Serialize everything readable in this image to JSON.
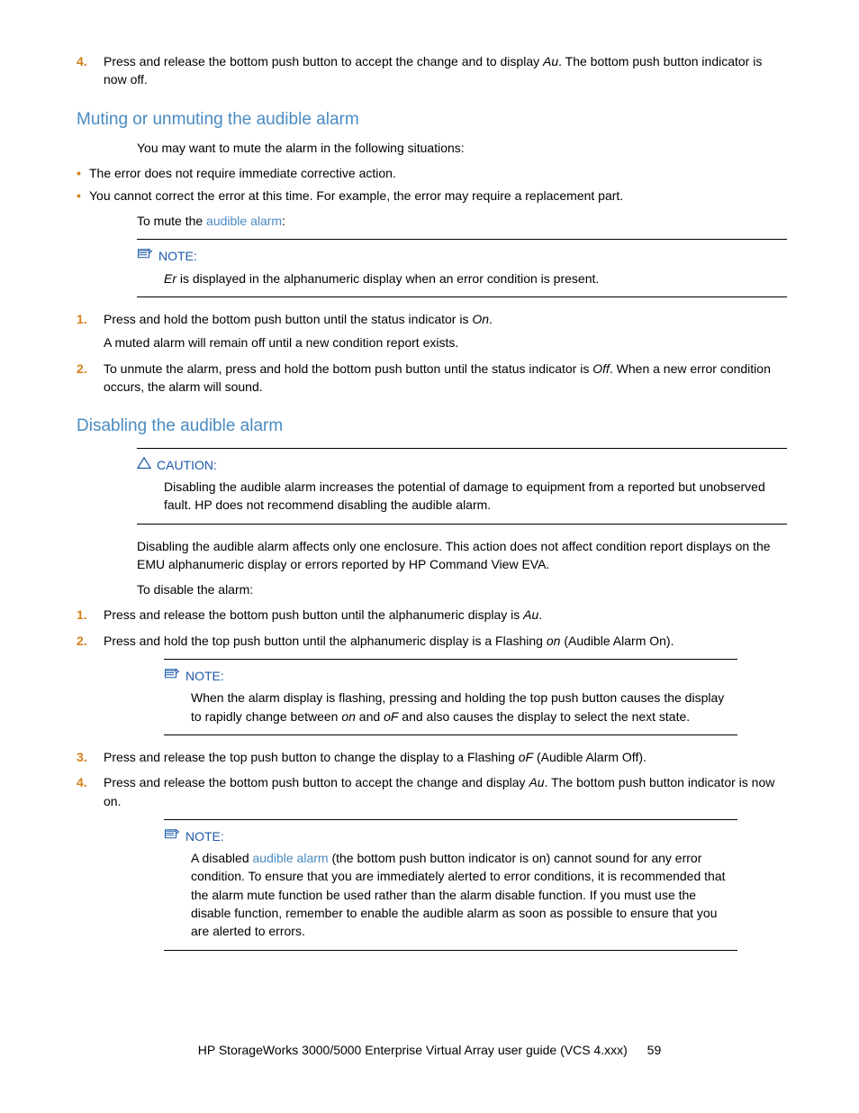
{
  "step4_top": {
    "num": "4.",
    "text_a": "Press and release the bottom push button to accept the change and to display ",
    "italic": "Au",
    "text_b": ". The bottom push button indicator is now off."
  },
  "section1": {
    "heading": "Muting or unmuting the audible alarm",
    "intro": "You may want to mute the alarm in the following situations:",
    "bullet1": "The error does not require immediate corrective action.",
    "bullet2": "You cannot correct the error at this time.  For example, the error may require a replacement part.",
    "to_mute_a": "To mute the ",
    "to_mute_link": "audible alarm",
    "to_mute_b": ":",
    "note_label": "NOTE:",
    "note_body_a": "Er",
    "note_body_b": " is displayed in the alphanumeric display when an error condition is present.",
    "step1": {
      "num": "1.",
      "text_a": "Press and hold the bottom push button until the status indicator is ",
      "italic": "On",
      "text_b": ".",
      "sub": "A muted alarm will remain off until a new condition report exists."
    },
    "step2": {
      "num": "2.",
      "text_a": "To unmute the alarm, press and hold the bottom push button until the status indicator is ",
      "italic": "Off",
      "text_b": ". When a new error condition occurs, the alarm will sound."
    }
  },
  "section2": {
    "heading": "Disabling the audible alarm",
    "caution_label": "CAUTION:",
    "caution_body": "Disabling the audible alarm increases the potential of damage to equipment from a reported but unobserved fault.  HP does not recommend disabling the audible alarm.",
    "para1": "Disabling the audible alarm affects only one enclosure.  This action does not affect condition report displays on the EMU alphanumeric display or errors reported by HP Command View EVA.",
    "para2": "To disable the alarm:",
    "step1": {
      "num": "1.",
      "text_a": "Press and release the bottom push button until the alphanumeric display is ",
      "italic": "Au",
      "text_b": "."
    },
    "step2": {
      "num": "2.",
      "text_a": "Press and hold the top push button until the alphanumeric display is a Flashing ",
      "italic": "on",
      "text_b": " (Audible Alarm On)."
    },
    "note1_label": "NOTE:",
    "note1_body_a": "When the alarm display is flashing, pressing and holding the top push button causes the display to rapidly change between ",
    "note1_i1": "on",
    "note1_body_b": " and ",
    "note1_i2": "oF",
    "note1_body_c": " and also causes the display to select the next state.",
    "step3": {
      "num": "3.",
      "text_a": "Press and release the top push button to change the display to a Flashing ",
      "italic": "oF",
      "text_b": " (Audible Alarm Off)."
    },
    "step4": {
      "num": "4.",
      "text_a": "Press and release the bottom push button to accept the change and display ",
      "italic": "Au",
      "text_b": ". The bottom push button indicator is now on."
    },
    "note2_label": "NOTE:",
    "note2_body_a": "A disabled ",
    "note2_link": "audible alarm",
    "note2_body_b": " (the bottom push button indicator is on) cannot sound for any error condition.  To ensure that you are immediately alerted to error conditions, it is recommended that the alarm mute function be used rather than the alarm disable function.  If you must use the disable function, remember to enable the audible alarm as soon as possible to ensure that you are alerted to errors."
  },
  "footer": {
    "title": "HP StorageWorks 3000/5000 Enterprise Virtual Array user guide (VCS 4.xxx)",
    "page": "59"
  }
}
